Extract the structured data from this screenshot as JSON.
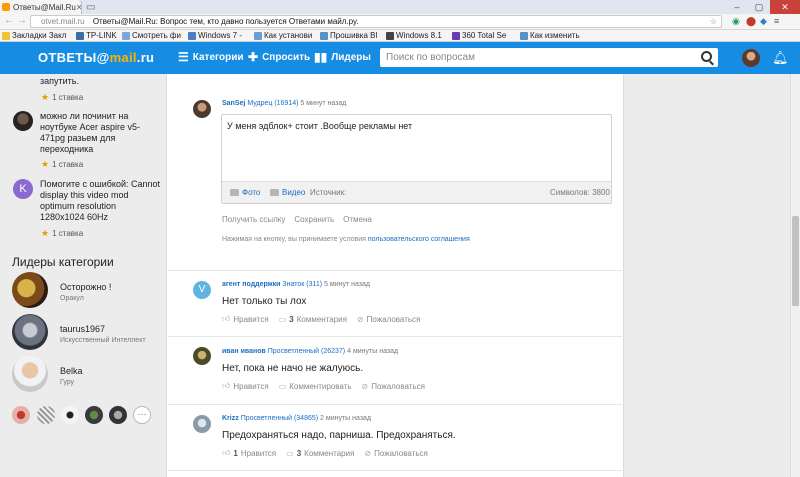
{
  "browser": {
    "tab_title": "Ответы@Mail.Ru",
    "url_host": "otvet.mail.ru",
    "url_title": "Ответы@Mail.Ru: Вопрос тем, кто давно пользуется Ответами майл.ру.",
    "bookmarks": [
      {
        "label": "Закладки Закл",
        "color": "#f1c232"
      },
      {
        "label": "TP-LINK",
        "color": "#3a6ea5"
      },
      {
        "label": "Смотреть фи",
        "color": "#7ea6d8"
      },
      {
        "label": "Windows 7 -",
        "color": "#4a7fc1"
      },
      {
        "label": "Как установи",
        "color": "#6a9fd4"
      },
      {
        "label": "Прошивка Bl",
        "color": "#5a8fc8"
      },
      {
        "label": "Windows 8.1",
        "color": "#444444"
      },
      {
        "label": "360 Total Se",
        "color": "#6a3bb8"
      },
      {
        "label": "Как изменить",
        "color": "#5a8fc8"
      }
    ]
  },
  "header": {
    "logo_prefix": "ОТВЕТЫ@",
    "logo_brand": "mail",
    "logo_suffix": ".ru",
    "nav": [
      {
        "label": "Категории",
        "icon": "list-icon"
      },
      {
        "label": "Спросить",
        "icon": "plus-icon"
      },
      {
        "label": "Лидеры",
        "icon": "bars-icon"
      }
    ],
    "search_placeholder": "Поиск по вопросам"
  },
  "sidebar": {
    "questions": [
      {
        "text": "запутить.",
        "rating": "1 ставка"
      },
      {
        "text": "можно ли починит на ноутбуке Acer aspire v5-471pg разьем для переходника",
        "rating": "1 ставка"
      },
      {
        "text": "Помогите с ошибкой: Cannot display this video mod optimum resolution 1280x1024 60Hz",
        "rating": "1 ставка",
        "avatar_letter": "K"
      }
    ],
    "leaders_title": "Лидеры категории",
    "leaders": [
      {
        "name": "Осторожно !",
        "rank": "Оракул"
      },
      {
        "name": "taurus1967",
        "rank": "Искусственный Интеллект"
      },
      {
        "name": "Belka",
        "rank": "Гуру"
      }
    ],
    "more_label": "···"
  },
  "editor": {
    "author": "SanSej",
    "rank": "Мудрец (16914)",
    "time": "5 минут назад",
    "text": "У меня эдблок+ стоит .Вообще рекламы нет",
    "tool_photo": "Фото",
    "tool_video": "Видео",
    "tool_source": "Источник:",
    "chars": "Символов: 3800",
    "link_get": "Получить ссылку",
    "link_save": "Сохранить",
    "link_cancel": "Отмена",
    "note": "Нажимая на кнопку, вы принимаете условия",
    "note_link": "пользовательского соглашения"
  },
  "answers": [
    {
      "author": "агент поддержки",
      "rank": "Знаток (311)",
      "time": "5 минут назад",
      "text": "Нет только ты лох",
      "like": "Нравится",
      "likes": "",
      "comments_count": "3",
      "comments": "Комментария",
      "report": "Пожаловаться",
      "avatar_letter": "V"
    },
    {
      "author": "иван иванов",
      "rank": "Просветленный (26237)",
      "time": "4 минуты назад",
      "text": "Нет, пока не начо не жалуюсь.",
      "like": "Нравится",
      "likes": "",
      "comments_count": "",
      "comments": "Комментировать",
      "report": "Пожаловаться"
    },
    {
      "author": "Krizz",
      "rank": "Просветленный (34865)",
      "time": "2 минуты назад",
      "text": "Предохраняться надо, парниша. Предохраняться.",
      "like": "Нравится",
      "likes": "1",
      "comments_count": "3",
      "comments": "Комментария",
      "report": "Пожаловаться"
    }
  ]
}
